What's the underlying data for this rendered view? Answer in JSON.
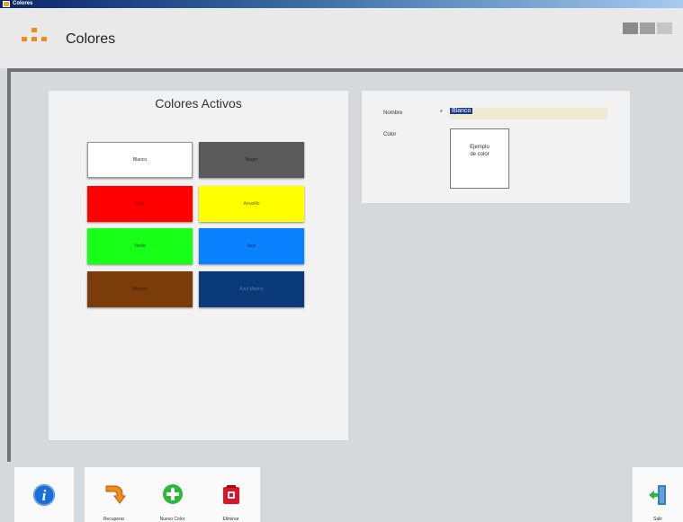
{
  "window": {
    "title": "Colores"
  },
  "header": {
    "title": "Colores"
  },
  "panel": {
    "title": "Colores Activos",
    "swatches": [
      {
        "label": "Blanco",
        "color": "#ffffff",
        "text_color": "#333333"
      },
      {
        "label": "Negro",
        "color": "#5a5a5a",
        "text_color": "#222222"
      },
      {
        "label": "Rojo",
        "color": "#ff0000",
        "text_color": "#8a0000"
      },
      {
        "label": "Amarillo",
        "color": "#ffff00",
        "text_color": "#666600"
      },
      {
        "label": "Verde",
        "color": "#18ff18",
        "text_color": "#0a6a0a"
      },
      {
        "label": "Azul",
        "color": "#0a82ff",
        "text_color": "#0a2a6a"
      },
      {
        "label": "Marron",
        "color": "#7a3d0a",
        "text_color": "#3a1a00"
      },
      {
        "label": "Azul Marino",
        "color": "#0b3a78",
        "text_color": "#5a7aa8"
      }
    ]
  },
  "detail": {
    "name_label": "Nombre",
    "required_mark": "*",
    "name_value": "Blanco",
    "color_label": "Color",
    "preview_text_1": "Ejemplo",
    "preview_text_2": "de color"
  },
  "toolbar": {
    "info_label": "",
    "restore_label": "Recuperar",
    "new_label": "Nuevo Color",
    "delete_label": "Eliminar",
    "exit_label": "Salir"
  },
  "colors": {
    "accent": "#f08c1a",
    "frame": "#6f7478",
    "info_blue": "#1a6ed8",
    "add_green": "#2db83a",
    "delete_red": "#d8182a"
  },
  "icons": {
    "app": "org-chart-icon",
    "info": "info-icon",
    "restore": "restore-arrow-icon",
    "new": "add-circle-icon",
    "delete": "trash-icon",
    "exit": "exit-door-icon"
  }
}
